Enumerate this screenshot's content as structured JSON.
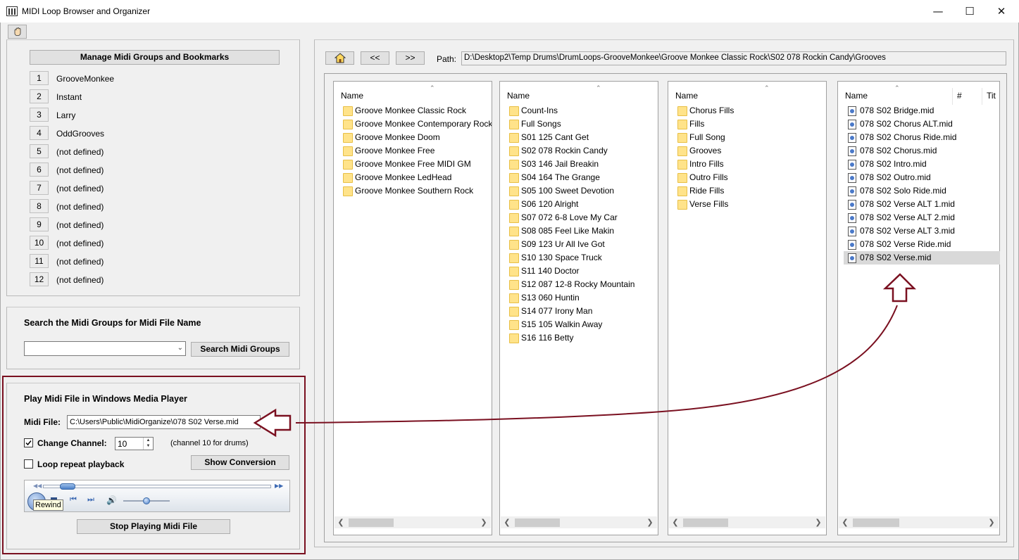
{
  "window": {
    "title": "MIDI Loop Browser and Organizer",
    "minimize": "—",
    "maximize": "☐",
    "close": "✕"
  },
  "toolbar": {
    "icon": "hand-icon"
  },
  "groups_panel": {
    "manage_button": "Manage Midi Groups and Bookmarks",
    "groups": [
      {
        "num": "1",
        "name": "GrooveMonkee"
      },
      {
        "num": "2",
        "name": "Instant"
      },
      {
        "num": "3",
        "name": "Larry"
      },
      {
        "num": "4",
        "name": "OddGrooves"
      },
      {
        "num": "5",
        "name": "(not defined)"
      },
      {
        "num": "6",
        "name": "(not defined)"
      },
      {
        "num": "7",
        "name": "(not defined)"
      },
      {
        "num": "8",
        "name": "(not defined)"
      },
      {
        "num": "9",
        "name": "(not defined)"
      },
      {
        "num": "10",
        "name": "(not defined)"
      },
      {
        "num": "11",
        "name": "(not defined)"
      },
      {
        "num": "12",
        "name": "(not defined)"
      }
    ]
  },
  "search_panel": {
    "title": "Search the Midi Groups for Midi File Name",
    "input_value": "",
    "button": "Search Midi  Groups"
  },
  "play_panel": {
    "title": "Play Midi File in Windows Media Player",
    "midi_file_label": "Midi File:",
    "midi_file_value": "C:\\Users\\Public\\MidiOrganize\\078 S02 Verse.mid",
    "change_channel_label": "Change Channel:",
    "change_channel_checked": true,
    "channel_value": "10",
    "channel_note": "(channel 10 for drums)",
    "loop_label": "Loop repeat playback",
    "loop_checked": false,
    "show_conversion_button": "Show Conversion",
    "tooltip": "Rewind",
    "stop_button": "Stop Playing Midi File",
    "seek_position": 0.07,
    "volume_level": 0.5
  },
  "nav": {
    "home_icon": "home-icon",
    "back_label": "<<",
    "forward_label": ">>",
    "path_label": "Path:",
    "path_value": "D:\\Desktop2\\Temp Drums\\DrumLoops-GrooveMonkee\\Groove Monkee Classic Rock\\S02 078 Rockin Candy\\Grooves"
  },
  "columns": [
    {
      "header": "Name",
      "items": [
        "Groove Monkee Classic Rock",
        "Groove Monkee Contemporary Rock",
        "Groove Monkee Doom",
        "Groove Monkee Free",
        "Groove Monkee Free MIDI GM",
        "Groove Monkee LedHead",
        "Groove Monkee Southern Rock"
      ]
    },
    {
      "header": "Name",
      "items": [
        "Count-Ins",
        "Full Songs",
        "S01 125 Cant Get",
        "S02 078 Rockin Candy",
        "S03 146 Jail Breakin",
        "S04 164 The Grange",
        "S05 100 Sweet Devotion",
        "S06 120 Alright",
        "S07 072 6-8 Love My Car",
        "S08 085 Feel Like Makin",
        "S09 123 Ur All Ive Got",
        "S10 130 Space Truck",
        "S11 140 Doctor",
        "S12 087 12-8 Rocky Mountain",
        "S13 060 Huntin",
        "S14 077 Irony Man",
        "S15 105 Walkin Away",
        "S16 116 Betty"
      ]
    },
    {
      "header": "Name",
      "items": [
        "Chorus Fills",
        "Fills",
        "Full Song",
        "Grooves",
        "Intro Fills",
        "Outro Fills",
        "Ride Fills",
        "Verse Fills"
      ]
    }
  ],
  "files": {
    "header_name": "Name",
    "header_num": "#",
    "header_title": "Tit",
    "items": [
      "078 S02 Bridge.mid",
      "078 S02 Chorus ALT.mid",
      "078 S02 Chorus Ride.mid",
      "078 S02 Chorus.mid",
      "078 S02 Intro.mid",
      "078 S02 Outro.mid",
      "078 S02 Solo Ride.mid",
      "078 S02 Verse ALT 1.mid",
      "078 S02 Verse ALT 2.mid",
      "078 S02 Verse ALT 3.mid",
      "078 S02 Verse Ride.mid",
      "078 S02 Verse.mid"
    ],
    "selected_index": 11
  },
  "colors": {
    "annotation": "#7a1020",
    "selection": "#d9d9d9"
  }
}
